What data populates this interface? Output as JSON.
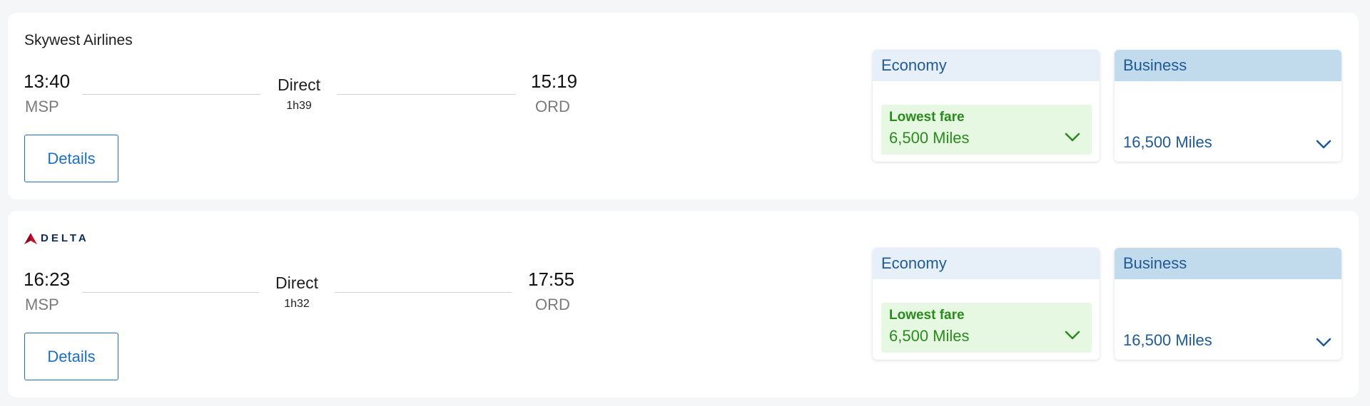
{
  "flights": [
    {
      "airline": "Skywest Airlines",
      "depart_time": "13:40",
      "depart_airport": "MSP",
      "stops": "Direct",
      "duration": "1h39",
      "arrive_time": "15:19",
      "arrive_airport": "ORD",
      "details_label": "Details",
      "economy": {
        "label": "Economy",
        "tag": "Lowest fare",
        "price": "6,500 Miles"
      },
      "business": {
        "label": "Business",
        "price": "16,500 Miles"
      }
    },
    {
      "airline": "DELTA",
      "depart_time": "16:23",
      "depart_airport": "MSP",
      "stops": "Direct",
      "duration": "1h32",
      "arrive_time": "17:55",
      "arrive_airport": "ORD",
      "details_label": "Details",
      "economy": {
        "label": "Economy",
        "tag": "Lowest fare",
        "price": "6,500 Miles"
      },
      "business": {
        "label": "Business",
        "price": "16,500 Miles"
      }
    }
  ],
  "icons": {
    "fare_expand": "chevron-down-icon",
    "delta_logo": "delta-widget-icon"
  },
  "colors": {
    "accent_blue": "#1b6fc2",
    "economy_header": "#e7f0f9",
    "business_header": "#c1daec",
    "lowest_fare_bg": "#e6f8e1",
    "lowest_fare_text": "#2b8a1d"
  }
}
